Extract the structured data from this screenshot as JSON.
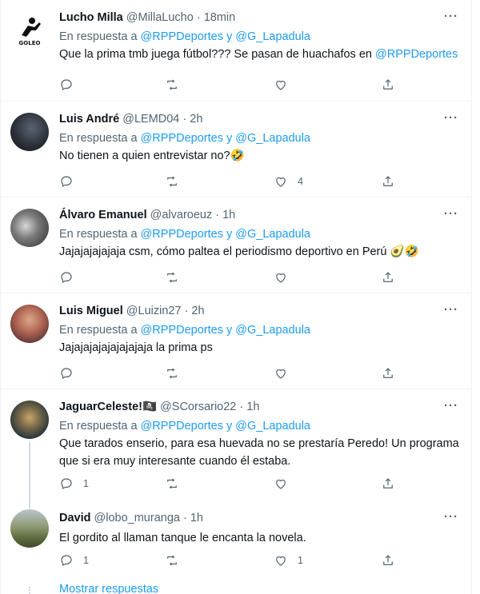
{
  "tweets": [
    {
      "name": "Lucho Milla",
      "handle": "@MillaLucho",
      "time": "· 18min",
      "reply_prefix": "En respuesta a",
      "reply_to_1": "@RPPDeportes",
      "reply_join": "y",
      "reply_to_2": "@G_Lapadula",
      "text_a": "Que la prima tmb juega fútbol??? Se pasan de huachafos en",
      "text_mention": "@RPPDeportes",
      "reply_count": "",
      "retweet_count": "",
      "like_count": ""
    },
    {
      "name": "Luis André",
      "handle": "@LEMD04",
      "time": "· 2h",
      "reply_prefix": "En respuesta a",
      "reply_to_1": "@RPPDeportes",
      "reply_join": "y",
      "reply_to_2": "@G_Lapadula",
      "text_a": "No tienen a quien entrevistar no?🤣",
      "reply_count": "",
      "retweet_count": "",
      "like_count": "4"
    },
    {
      "name": "Álvaro Emanuel",
      "handle": "@alvaroeuz",
      "time": "· 1h",
      "reply_prefix": "En respuesta a",
      "reply_to_1": "@RPPDeportes",
      "reply_join": "y",
      "reply_to_2": "@G_Lapadula",
      "text_a": "Jajajajajajaja csm, cómo paltea el periodismo deportivo en Perú 🥑🤣",
      "reply_count": "",
      "retweet_count": "",
      "like_count": ""
    },
    {
      "name": "Luis Miguel",
      "handle": "@Luizin27",
      "time": "· 2h",
      "reply_prefix": "En respuesta a",
      "reply_to_1": "@RPPDeportes",
      "reply_join": "y",
      "reply_to_2": "@G_Lapadula",
      "text_a": "Jajajajajajajajajaja la prima ps",
      "reply_count": "",
      "retweet_count": "",
      "like_count": ""
    },
    {
      "name": "JaguarCeleste!🏴‍☠️",
      "handle": "@SCorsario22",
      "time": "· 1h",
      "reply_prefix": "En respuesta a",
      "reply_to_1": "@RPPDeportes",
      "reply_join": "y",
      "reply_to_2": "@G_Lapadula",
      "text_a": "Que tarados enserio, para esa huevada no se prestaría Peredo! Un programa que si era muy interesante cuando él estaba.",
      "reply_count": "1",
      "retweet_count": "",
      "like_count": ""
    },
    {
      "name": "David",
      "handle": "@lobo_muranga",
      "time": "· 1h",
      "text_a": "El gordito al llaman tanque le encanta la novela.",
      "reply_count": "1",
      "retweet_count": "",
      "like_count": "1"
    }
  ],
  "more_icon": "···",
  "show_more": "Mostrar respuestas",
  "colors": {
    "link": "#1d9bf0",
    "secondary": "#536471",
    "text": "#0f1419",
    "border": "#eff3f4"
  }
}
